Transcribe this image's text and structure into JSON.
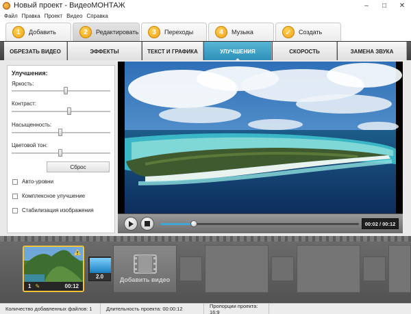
{
  "window": {
    "title": "Новый проект - ВидеоМОНТАЖ",
    "controls": [
      "–",
      "□",
      "✕"
    ]
  },
  "menu": [
    "Файл",
    "Правка",
    "Проект",
    "Видео",
    "Справка"
  ],
  "steps": [
    {
      "num": "1",
      "label": "Добавить"
    },
    {
      "num": "2",
      "label": "Редактировать",
      "active": true
    },
    {
      "num": "3",
      "label": "Переходы"
    },
    {
      "num": "4",
      "label": "Музыка"
    },
    {
      "num": "",
      "label": "Создать",
      "icon": "checkmark-icon"
    }
  ],
  "subtabs": [
    {
      "label": "ОБРЕЗАТЬ ВИДЕО"
    },
    {
      "label": "ЭФФЕКТЫ"
    },
    {
      "label": "ТЕКСТ И ГРАФИКА"
    },
    {
      "label": "УЛУЧШЕНИЯ",
      "active": true
    },
    {
      "label": "СКОРОСТЬ"
    },
    {
      "label": "ЗАМЕНА ЗВУКА"
    }
  ],
  "enhancements": {
    "title": "Улучшения:",
    "sliders": [
      {
        "label": "Яркость:",
        "value": 0.55
      },
      {
        "label": "Контраст:",
        "value": 0.58
      },
      {
        "label": "Насыщенность:",
        "value": 0.49
      },
      {
        "label": "Цветовой тон:",
        "value": 0.49
      }
    ],
    "reset_label": "Сброс",
    "checkboxes": [
      {
        "label": "Авто-уровни",
        "checked": false
      },
      {
        "label": "Комплексное улучшение",
        "checked": false
      },
      {
        "label": "Стабилизация изображения",
        "checked": false
      }
    ]
  },
  "player": {
    "time": "00:02 / 00:12",
    "progress": 0.17
  },
  "timeline": {
    "clip_number": "1",
    "clip_duration": "00:12",
    "transition_duration": "2.0",
    "add_video_label": "Добавить видео"
  },
  "status": {
    "files": "Количество добавленных файлов: 1",
    "duration": "Длительность проекта: 00:00:12",
    "aspect": "Пропорции проекта: 16:9"
  },
  "colors": {
    "accent": "#2b8fb7",
    "step_badge": "#f0a010",
    "clip_border": "#f0c53c"
  }
}
